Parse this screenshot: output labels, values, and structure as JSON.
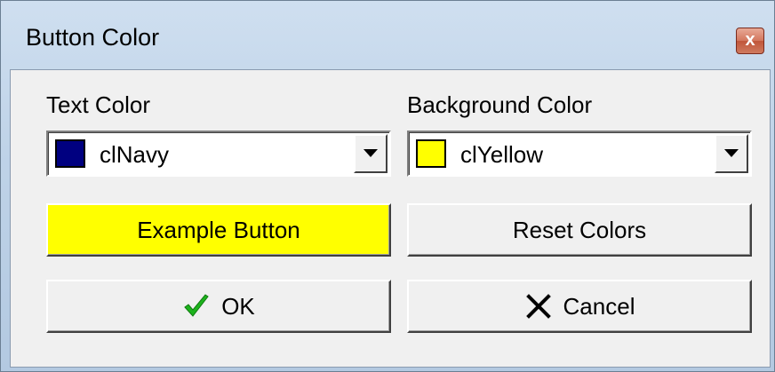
{
  "window": {
    "title": "Button Color",
    "close_glyph": "x"
  },
  "text_color": {
    "label": "Text Color",
    "value": "clNavy",
    "swatch_color": "#000080"
  },
  "background_color": {
    "label": "Background Color",
    "value": "clYellow",
    "swatch_color": "#ffff00"
  },
  "buttons": {
    "example_label": "Example Button",
    "reset_label": "Reset Colors",
    "ok_label": "OK",
    "cancel_label": "Cancel"
  },
  "icons": {
    "ok": "checkmark-icon",
    "cancel": "x-cross-icon",
    "dropdown": "dropdown-arrow-icon"
  },
  "colors": {
    "check_green": "#1db31d"
  }
}
